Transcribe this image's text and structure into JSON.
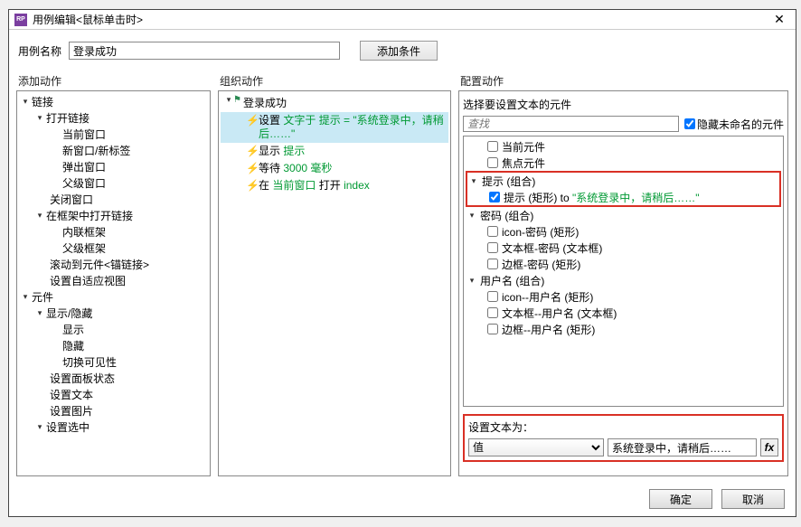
{
  "window": {
    "title": "用例编辑<鼠标单击时>"
  },
  "name_row": {
    "label": "用例名称",
    "value": "登录成功",
    "add_condition": "添加条件"
  },
  "col_headers": {
    "add_action": "添加动作",
    "organize": "组织动作",
    "configure": "配置动作"
  },
  "add_tree": {
    "links": "链接",
    "open_link": "打开链接",
    "current_window": "当前窗口",
    "new_window": "新窗口/新标签",
    "popup": "弹出窗口",
    "parent_window": "父级窗口",
    "close_window": "关闭窗口",
    "open_in_frame": "在框架中打开链接",
    "inline_frame": "内联框架",
    "parent_frame": "父级框架",
    "scroll_to": "滚动到元件<锚链接>",
    "adaptive": "设置自适应视图",
    "widgets": "元件",
    "show_hide": "显示/隐藏",
    "show": "显示",
    "hide": "隐藏",
    "toggle": "切换可见性",
    "panel_state": "设置面板状态",
    "set_text": "设置文本",
    "set_image": "设置图片",
    "set_selected": "设置选中"
  },
  "organize": {
    "root": "登录成功",
    "a1_pre": "设置",
    "a1_mid": "文字于 提示 = \"系统登录中，请稍后……\"",
    "a2_pre": "显示",
    "a2_mid": "提示",
    "a3_pre": "等待",
    "a3_mid": "3000 毫秒",
    "a4_pre": "在",
    "a4_mid": "当前窗口",
    "a4_mid2": "打开",
    "a4_mid3": "index"
  },
  "configure": {
    "select_widget": "选择要设置文本的元件",
    "search_placeholder": "查找",
    "hide_unnamed": "隐藏未命名的元件",
    "current_widget": "当前元件",
    "focus_widget": "焦点元件",
    "tip_group": "提示 (组合)",
    "tip_rect_pre": "提示 (矩形) to",
    "tip_rect_val": "\"系统登录中，请稍后……\"",
    "pwd_group": "密码 (组合)",
    "pwd_icon": "icon-密码 (矩形)",
    "pwd_text": "文本框-密码 (文本框)",
    "pwd_border": "边框-密码 (矩形)",
    "user_group": "用户名 (组合)",
    "user_icon": "icon--用户名 (矩形)",
    "user_text": "文本框--用户名 (文本框)",
    "user_border": "边框--用户名 (矩形)",
    "set_text_to": "设置文本为：",
    "value_option": "值",
    "text_value": "系统登录中，请稍后……",
    "fx": "fx"
  },
  "footer": {
    "ok": "确定",
    "cancel": "取消"
  }
}
